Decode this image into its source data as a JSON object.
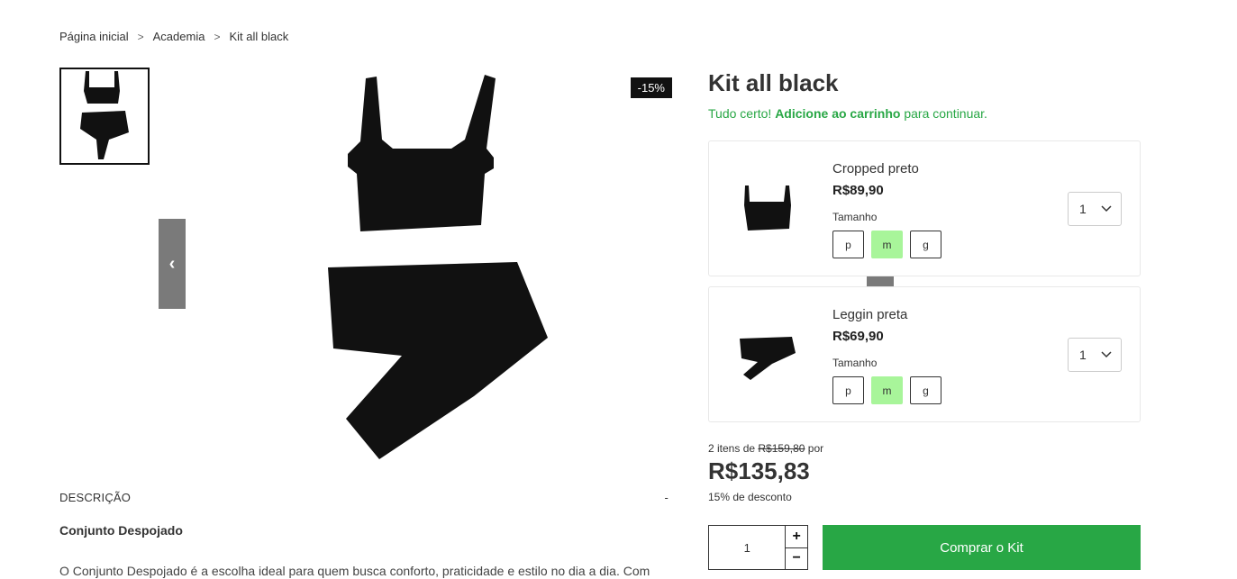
{
  "breadcrumb": {
    "items": [
      "Página inicial",
      "Academia",
      "Kit all black"
    ],
    "separator": ">"
  },
  "gallery": {
    "discount_badge": "-15%",
    "prev_icon": "chevron-left-icon",
    "next_icon": "chevron-right-icon"
  },
  "description": {
    "heading": "DESCRIÇÃO",
    "toggle": "-",
    "title": "Conjunto Despojado",
    "text": "O Conjunto Despojado é a escolha ideal para quem busca conforto, praticidade e estilo no dia a dia. Com"
  },
  "product": {
    "title": "Kit all black",
    "tagline_prefix": "Tudo certo!",
    "tagline_bold": "Adicione ao carrinho",
    "tagline_suffix": "para continuar."
  },
  "items": [
    {
      "name": "Cropped preto",
      "price": "R$89,90",
      "size_label": "Tamanho",
      "sizes": [
        "p",
        "m",
        "g"
      ],
      "selected_size": "m",
      "quantity": "1"
    },
    {
      "name": "Leggin preta",
      "price": "R$69,90",
      "size_label": "Tamanho",
      "sizes": [
        "p",
        "m",
        "g"
      ],
      "selected_size": "m",
      "quantity": "1"
    }
  ],
  "summary": {
    "prefix": "2 itens de",
    "old_price": "R$159,80",
    "suffix": "por",
    "total": "R$135,83",
    "discount": "15% de desconto"
  },
  "purchase": {
    "quantity": "1",
    "plus": "+",
    "minus": "−",
    "buy_label": "Comprar o Kit"
  },
  "colors": {
    "accent_green": "#28a745",
    "selected_size": "#a8f59a",
    "badge": "#111111",
    "arrow_bg": "#7a7a7a"
  }
}
